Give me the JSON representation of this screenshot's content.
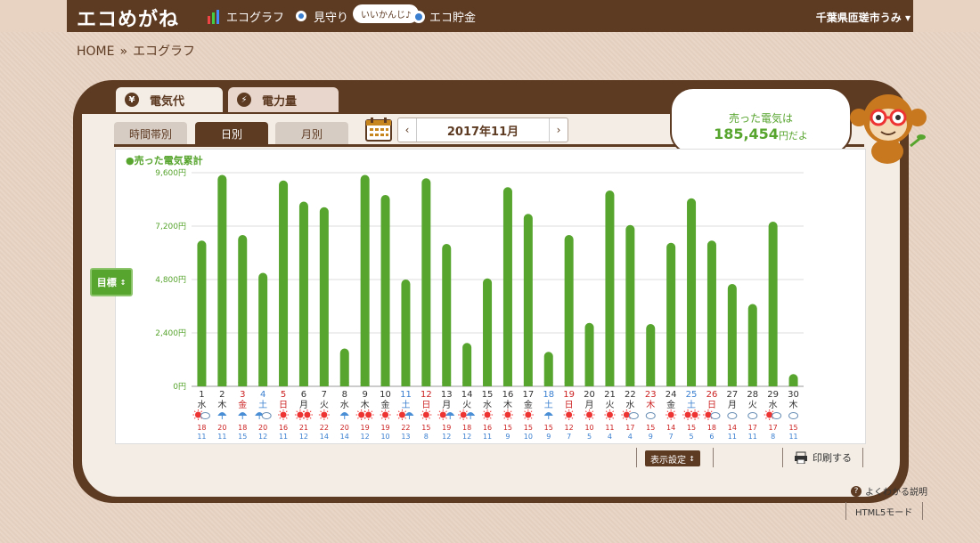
{
  "header": {
    "logo": "エコめがね",
    "nav": [
      {
        "label": "エコグラフ",
        "icon": "bar-chart-icon"
      },
      {
        "label": "見守り",
        "icon": "watch-eye-icon"
      },
      {
        "label": "エコ貯金",
        "icon": "coin-icon"
      }
    ],
    "bubble": "いいかんじ♪",
    "user": "千葉県匝瑳市うみ"
  },
  "breadcrumb": {
    "home": "HOME",
    "sep": "»",
    "current": "エコグラフ"
  },
  "main_tabs": [
    {
      "label": "電気代",
      "icon_char": "¥",
      "active": true
    },
    {
      "label": "電力量",
      "icon_char": "⚡",
      "active": false
    }
  ],
  "sub_tabs": [
    {
      "label": "時間帯別",
      "active": false
    },
    {
      "label": "日別",
      "active": true
    },
    {
      "label": "月別",
      "active": false
    }
  ],
  "date": {
    "label": "2017年11月"
  },
  "summary": {
    "line1": "売った電気は",
    "amount": "185,454",
    "suffix": "円だよ"
  },
  "target_button": "目標",
  "display_button": "表示設定",
  "print_button": "印刷する",
  "help": "よくわかる説明",
  "html5": "HTML5モード",
  "colors": {
    "brown": "#5d3a22",
    "green": "#57a42e",
    "red": "#cc2222",
    "blue": "#3a7fd0"
  },
  "chart_data": {
    "type": "bar",
    "legend": "●売った電気累計",
    "yticks": [
      "0円",
      "2,400円",
      "4,800円",
      "7,200円",
      "9,600円"
    ],
    "ylim": [
      0,
      9600
    ],
    "categories": [
      "1",
      "2",
      "3",
      "4",
      "5",
      "6",
      "7",
      "8",
      "9",
      "10",
      "11",
      "12",
      "13",
      "14",
      "15",
      "16",
      "17",
      "18",
      "19",
      "20",
      "21",
      "22",
      "23",
      "24",
      "25",
      "26",
      "27",
      "28",
      "29",
      "30"
    ],
    "weekday": [
      "水",
      "木",
      "金",
      "土",
      "日",
      "月",
      "火",
      "水",
      "木",
      "金",
      "土",
      "日",
      "月",
      "火",
      "水",
      "木",
      "金",
      "土",
      "日",
      "月",
      "火",
      "水",
      "木",
      "金",
      "土",
      "日",
      "月",
      "火",
      "水",
      "木"
    ],
    "day_color": [
      "n",
      "n",
      "r",
      "b",
      "r",
      "n",
      "n",
      "n",
      "n",
      "n",
      "b",
      "r",
      "n",
      "n",
      "n",
      "n",
      "n",
      "b",
      "r",
      "n",
      "n",
      "n",
      "r",
      "n",
      "b",
      "r",
      "n",
      "n",
      "n",
      "n"
    ],
    "values": [
      6550,
      9500,
      6800,
      5100,
      9250,
      8300,
      8050,
      1700,
      9500,
      8600,
      4800,
      9350,
      6400,
      1950,
      4850,
      8950,
      7750,
      1550,
      6800,
      2850,
      8800,
      7250,
      2800,
      6450,
      8450,
      6550,
      4600,
      3700,
      7400,
      550
    ],
    "weather": [
      "sunny-cloudy",
      "rainy",
      "rainy",
      "rainy-cloudy",
      "sunny",
      "sunny-sunny",
      "sunny",
      "rainy",
      "sunny-sunny",
      "sunny",
      "sunny-rainy",
      "sunny",
      "sunny-rainy",
      "sunny-rainy",
      "sunny",
      "sunny",
      "sunny",
      "rainy",
      "sunny",
      "sunny",
      "sunny",
      "sunny-cloudy",
      "cloudy",
      "sunny",
      "sunny-sunny",
      "sunny-cloudy",
      "cloudy",
      "cloudy",
      "sunny-cloudy",
      "cloudy"
    ],
    "temp_high": [
      "18",
      "20",
      "18",
      "20",
      "16",
      "21",
      "22",
      "20",
      "19",
      "19",
      "22",
      "15",
      "19",
      "18",
      "16",
      "15",
      "15",
      "15",
      "12",
      "10",
      "11",
      "17",
      "15",
      "14",
      "15",
      "18",
      "14",
      "17",
      "17",
      "15"
    ],
    "temp_low": [
      "11",
      "11",
      "15",
      "12",
      "11",
      "12",
      "14",
      "14",
      "12",
      "10",
      "13",
      "8",
      "12",
      "12",
      "11",
      "9",
      "10",
      "9",
      "7",
      "5",
      "4",
      "4",
      "9",
      "7",
      "5",
      "6",
      "11",
      "11",
      "8",
      "11"
    ]
  }
}
